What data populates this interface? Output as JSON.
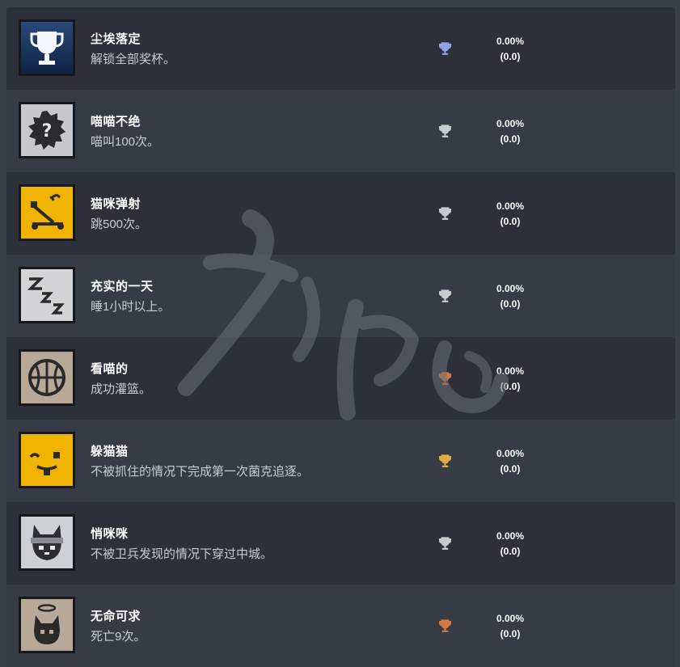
{
  "achievements": [
    {
      "title": "尘埃落定",
      "desc": "解锁全部奖杯。",
      "percent": "0.00%",
      "score": "(0.0)",
      "trophy": "platinum",
      "trophy_color": "#8fa3e0",
      "icon": "trophy-icon"
    },
    {
      "title": "喵喵不绝",
      "desc": "喵叫100次。",
      "percent": "0.00%",
      "score": "(0.0)",
      "trophy": "silver",
      "trophy_color": "#c9cbd0",
      "icon": "question-burst-icon"
    },
    {
      "title": "猫咪弹射",
      "desc": "跳500次。",
      "percent": "0.00%",
      "score": "(0.0)",
      "trophy": "silver",
      "trophy_color": "#c9cbd0",
      "icon": "catapult-icon"
    },
    {
      "title": "充实的一天",
      "desc": "睡1小时以上。",
      "percent": "0.00%",
      "score": "(0.0)",
      "trophy": "silver",
      "trophy_color": "#c9cbd0",
      "icon": "sleep-zzz-icon"
    },
    {
      "title": "看喵的",
      "desc": "成功灌篮。",
      "percent": "0.00%",
      "score": "(0.0)",
      "trophy": "bronze",
      "trophy_color": "#d27a46",
      "icon": "basketball-icon"
    },
    {
      "title": "躲猫猫",
      "desc": "不被抓住的情况下完成第一次菌克追逐。",
      "percent": "0.00%",
      "score": "(0.0)",
      "trophy": "gold",
      "trophy_color": "#e2aa43",
      "icon": "wink-face-icon"
    },
    {
      "title": "悄咪咪",
      "desc": "不被卫兵发现的情况下穿过中城。",
      "percent": "0.00%",
      "score": "(0.0)",
      "trophy": "silver",
      "trophy_color": "#c9cbd0",
      "icon": "ninja-cat-icon"
    },
    {
      "title": "无命可求",
      "desc": "死亡9次。",
      "percent": "0.00%",
      "score": "(0.0)",
      "trophy": "bronze",
      "trophy_color": "#d27a46",
      "icon": "angel-cat-icon"
    }
  ]
}
